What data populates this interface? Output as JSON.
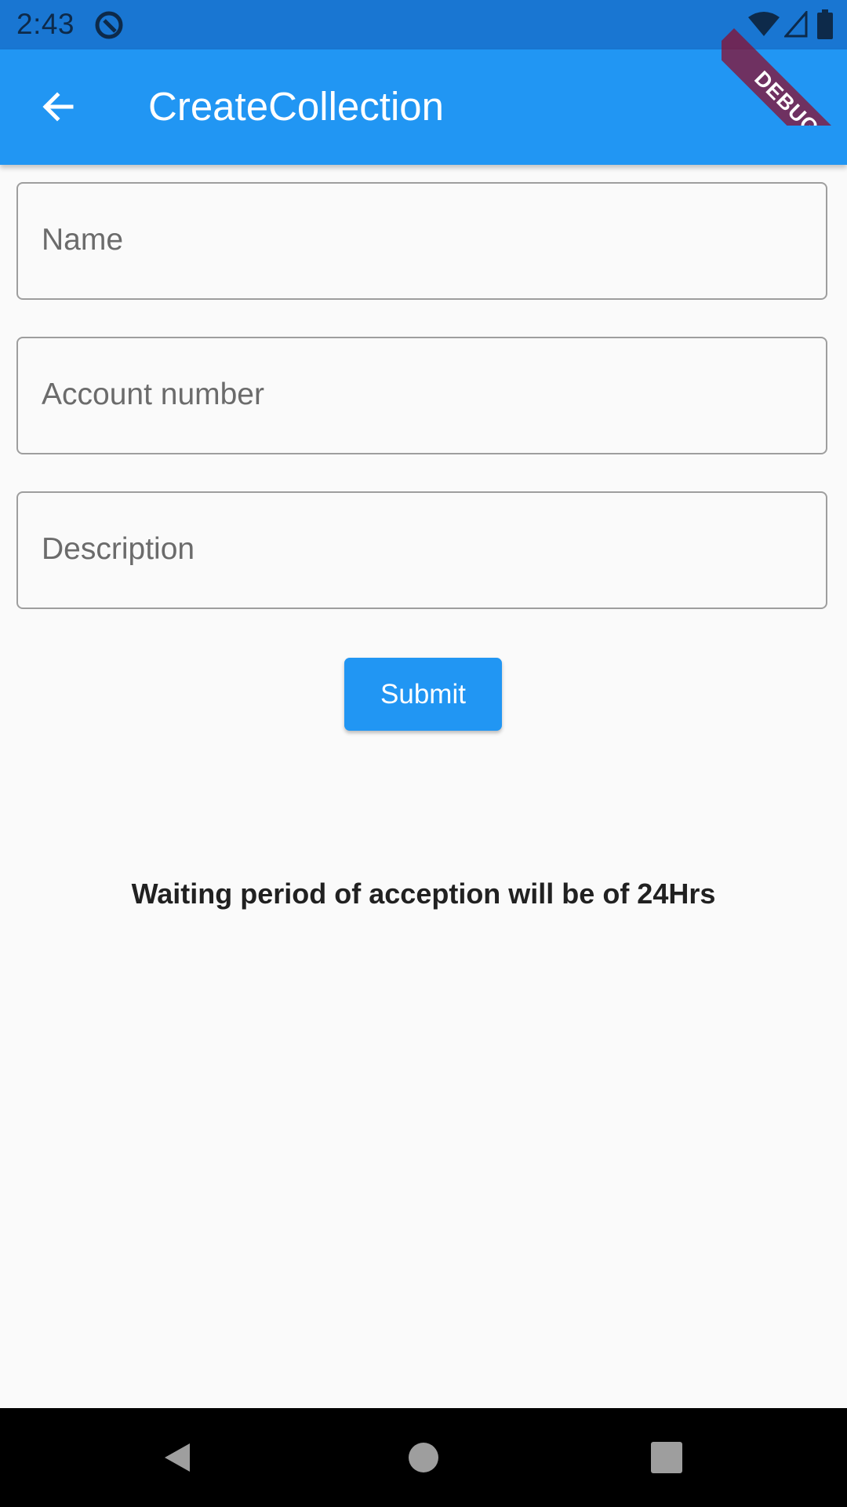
{
  "status_bar": {
    "time": "2:43",
    "app_icon": "notification-app-icon",
    "icons": [
      "wifi-icon",
      "signal-icon",
      "battery-icon"
    ]
  },
  "debug_banner": {
    "label": "DEBUG"
  },
  "app_bar": {
    "title": "CreateCollection",
    "back_icon": "arrow-back-icon",
    "color": "#2196f3"
  },
  "form": {
    "fields": [
      {
        "placeholder": "Name",
        "value": ""
      },
      {
        "placeholder": "Account number",
        "value": ""
      },
      {
        "placeholder": "Description",
        "value": ""
      }
    ],
    "submit_label": "Submit",
    "note": "Waiting period of acception will be of 24Hrs"
  },
  "nav_bar": {
    "icons": [
      "nav-back-icon",
      "nav-home-icon",
      "nav-recents-icon"
    ]
  },
  "colors": {
    "accent": "#2196f3",
    "status_bar": "#1976d2",
    "background": "#fafafa"
  }
}
